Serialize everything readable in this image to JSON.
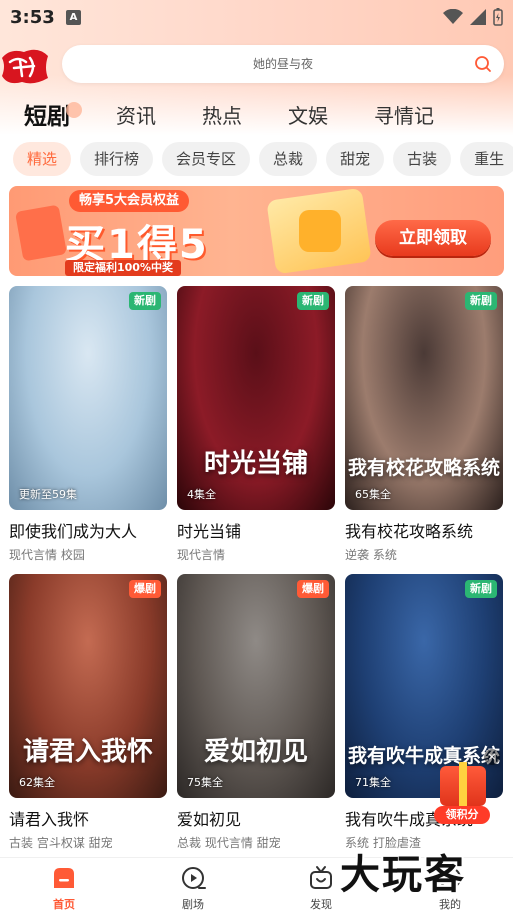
{
  "status_bar": {
    "time": "3:53",
    "indicator": "A"
  },
  "search": {
    "placeholder": "她的昼与夜"
  },
  "tabs": [
    {
      "label": "短剧",
      "active": true
    },
    {
      "label": "资讯",
      "active": false
    },
    {
      "label": "热点",
      "active": false
    },
    {
      "label": "文娱",
      "active": false
    },
    {
      "label": "寻情记",
      "active": false
    }
  ],
  "chips": [
    {
      "label": "精选",
      "active": true
    },
    {
      "label": "排行榜",
      "active": false
    },
    {
      "label": "会员专区",
      "active": false
    },
    {
      "label": "总裁",
      "active": false
    },
    {
      "label": "甜宠",
      "active": false
    },
    {
      "label": "古装",
      "active": false
    },
    {
      "label": "重生",
      "active": false
    }
  ],
  "banner": {
    "top_text": "畅享5大会员权益",
    "big_text": "买1得5",
    "bottom_text": "限定福利100%中奖",
    "cta": "立即领取"
  },
  "dramas": [
    {
      "title": "即使我们成为大人",
      "tags": "现代言情 校园",
      "episodes": "更新至59集",
      "badge": "新剧",
      "badge_type": "new",
      "poster_text": "",
      "colors": [
        "#d9e7f2",
        "#a9c6dc",
        "#6e8ea8"
      ]
    },
    {
      "title": "时光当铺",
      "tags": "现代言情",
      "episodes": "4集全",
      "badge": "新剧",
      "badge_type": "new",
      "poster_text": "时光当铺",
      "colors": [
        "#5a0f18",
        "#8c1b27",
        "#2a0508"
      ]
    },
    {
      "title": "我有校花攻略系统",
      "tags": "逆袭 系统",
      "episodes": "65集全",
      "badge": "新剧",
      "badge_type": "new",
      "poster_text": "我有校花攻略系统",
      "colors": [
        "#4b3a36",
        "#9c7c6d",
        "#2b201d"
      ]
    },
    {
      "title": "请君入我怀",
      "tags": "古装 宫斗权谋 甜宠",
      "episodes": "62集全",
      "badge": "爆剧",
      "badge_type": "hot",
      "poster_text": "请君入我怀",
      "colors": [
        "#c46b52",
        "#8a3b2a",
        "#3a1a12"
      ]
    },
    {
      "title": "爱如初见",
      "tags": "总裁 现代言情 甜宠",
      "episodes": "75集全",
      "badge": "爆剧",
      "badge_type": "hot",
      "poster_text": "爱如初见",
      "colors": [
        "#8f8a86",
        "#5e5752",
        "#2c2826"
      ]
    },
    {
      "title": "我有吹牛成真系统",
      "tags": "系统 打脸虐渣",
      "episodes": "71集全",
      "badge": "新剧",
      "badge_type": "new",
      "poster_text": "我有吹牛成真系统",
      "colors": [
        "#3a67a8",
        "#1e3f73",
        "#0e1f3d"
      ]
    }
  ],
  "reward": {
    "label": "领积分",
    "close": "×"
  },
  "bottom_nav": [
    {
      "label": "首页",
      "icon": "home-icon",
      "active": true
    },
    {
      "label": "剧场",
      "icon": "theater-icon",
      "active": false
    },
    {
      "label": "发现",
      "icon": "tv-icon",
      "active": false
    },
    {
      "label": "我的",
      "icon": "profile-icon",
      "active": false
    }
  ],
  "watermark": "大玩客",
  "colors": {
    "accent": "#ff5a36",
    "badge_new": "#2bb673",
    "badge_hot": "#ff5a36"
  }
}
